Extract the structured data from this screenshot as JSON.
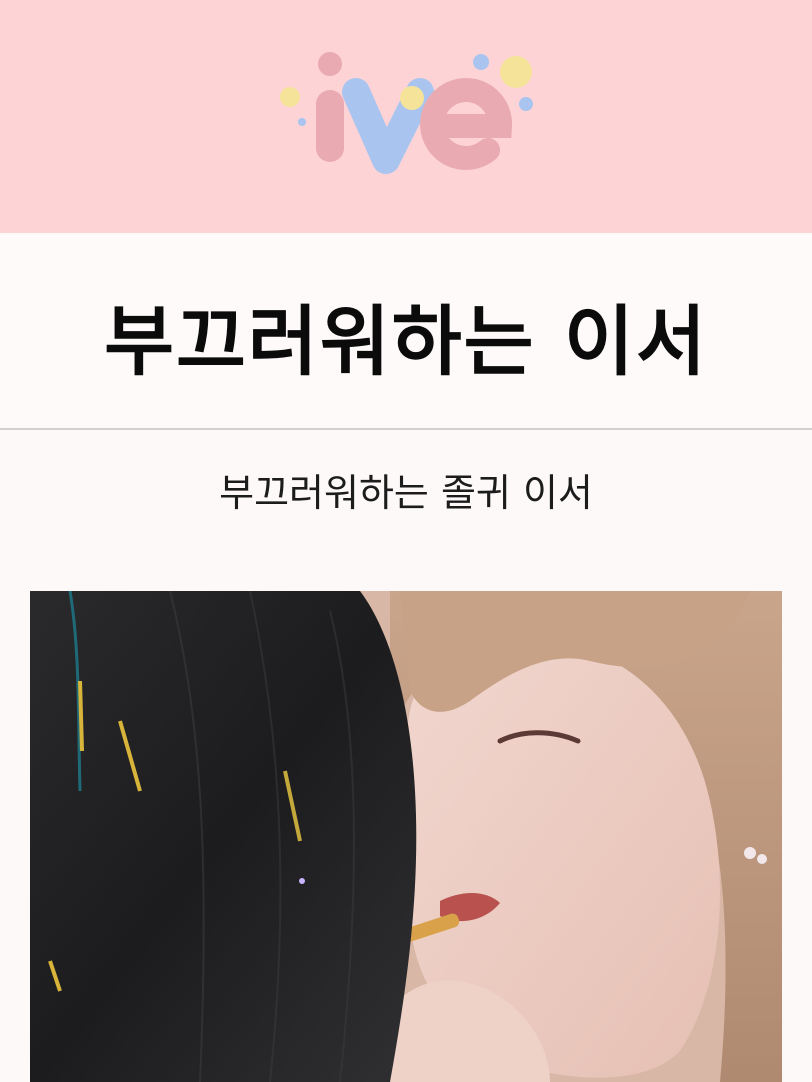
{
  "header": {
    "logo_text": "ive",
    "background_color": "#fdd3d6",
    "logo_colors": {
      "i": "#e9aab1",
      "v": "#a9c4ef",
      "e": "#e9aab1",
      "dots": [
        "#f6e39a",
        "#a9c4ef",
        "#f6d98a"
      ]
    }
  },
  "post": {
    "title": "부끄러워하는 이서",
    "subtitle": "부끄러워하는 졸귀 이서"
  },
  "photo": {
    "subject": "photo-of-two-people-close-up"
  }
}
